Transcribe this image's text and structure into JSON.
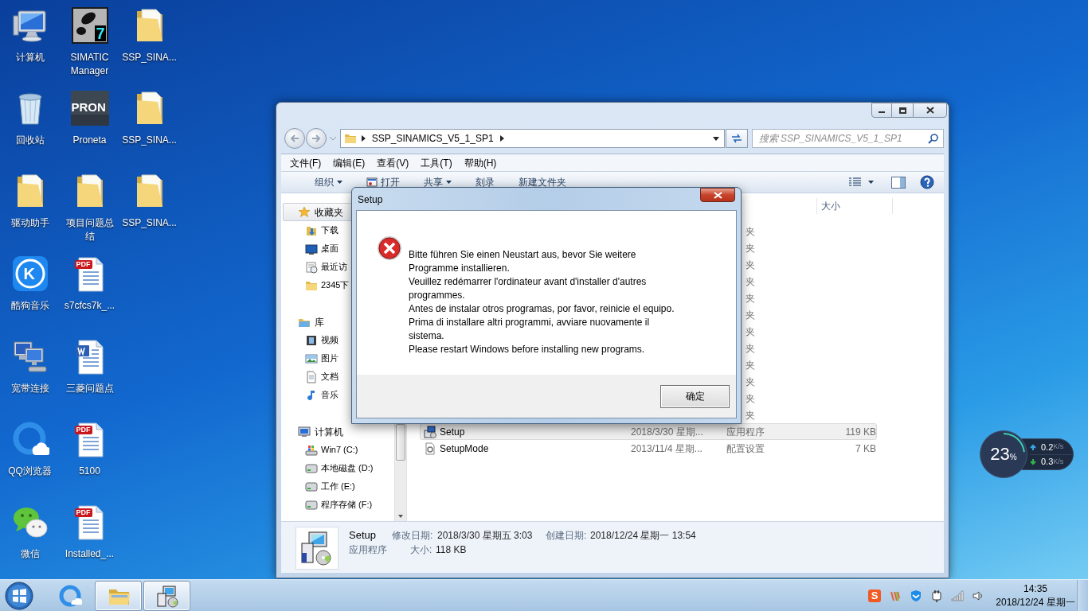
{
  "desktop": {
    "icons": [
      {
        "label": "计算机",
        "kind": "computer"
      },
      {
        "label": "回收站",
        "kind": "recycle"
      },
      {
        "label": "驱动助手",
        "kind": "folder"
      },
      {
        "label": "酷狗音乐",
        "kind": "kugou",
        "glyph": "K"
      },
      {
        "label": "宽带连接",
        "kind": "network"
      },
      {
        "label": "QQ浏览器",
        "kind": "qqbrowser"
      },
      {
        "label": "微信",
        "kind": "wechat"
      },
      {
        "label": "SIMATIC Manager",
        "kind": "simatic",
        "glyph": "7"
      },
      {
        "label": "Proneta",
        "kind": "proneta",
        "glyph": "PRON"
      },
      {
        "label": "项目问题总结",
        "kind": "folder"
      },
      {
        "label": "s7cfcs7k_...",
        "kind": "pdf",
        "glyph": "PDF"
      },
      {
        "label": "三菱问题点",
        "kind": "word"
      },
      {
        "label": "5100",
        "kind": "pdf",
        "glyph": "PDF"
      },
      {
        "label": "Installed_...",
        "kind": "pdf",
        "glyph": "PDF"
      },
      {
        "label": "SSP_SINA...",
        "kind": "folder"
      },
      {
        "label": "SSP_SINA...",
        "kind": "folder"
      },
      {
        "label": "SSP_SINA...",
        "kind": "folder"
      }
    ]
  },
  "explorer": {
    "address": {
      "crumbs": [
        "SSP_SINAMICS_V5_1_SP1"
      ]
    },
    "search": {
      "placeholder": "搜索 SSP_SINAMICS_V5_1_SP1"
    },
    "menu": [
      "文件(F)",
      "编辑(E)",
      "查看(V)",
      "工具(T)",
      "帮助(H)"
    ],
    "toolbar": [
      {
        "label": "组织",
        "kind": "dropdown"
      },
      {
        "label": "打开",
        "kind": "icon"
      },
      {
        "label": "共享",
        "kind": "dropdown"
      },
      {
        "label": "刻录",
        "kind": "plain"
      },
      {
        "label": "新建文件夹",
        "kind": "plain"
      }
    ],
    "nav": [
      {
        "label": "收藏夹",
        "kind": "star",
        "highlighted": true,
        "children": [
          {
            "label": "下载",
            "kind": "download"
          },
          {
            "label": "桌面",
            "kind": "desktop"
          },
          {
            "label": "最近访",
            "kind": "recent"
          },
          {
            "label": "2345下",
            "kind": "folder"
          }
        ]
      },
      {
        "label": "库",
        "kind": "library",
        "highlighted": false,
        "children": [
          {
            "label": "视频",
            "kind": "video"
          },
          {
            "label": "图片",
            "kind": "picture"
          },
          {
            "label": "文档",
            "kind": "document"
          },
          {
            "label": "音乐",
            "kind": "music"
          }
        ]
      },
      {
        "label": "计算机",
        "kind": "computer",
        "highlighted": false,
        "children": [
          {
            "label": "Win7 (C:)",
            "kind": "windrive"
          },
          {
            "label": "本地磁盘 (D:)",
            "kind": "drive"
          },
          {
            "label": "工作 (E:)",
            "kind": "drive"
          },
          {
            "label": "程序存储 (F:)",
            "kind": "drive"
          }
        ]
      }
    ],
    "columns": [
      {
        "label": "大小"
      }
    ],
    "rows": [
      {
        "type": "夹",
        "selected": false
      },
      {
        "type": "夹",
        "selected": false
      },
      {
        "type": "夹",
        "selected": false
      },
      {
        "type": "夹",
        "selected": false
      },
      {
        "type": "夹",
        "selected": false
      },
      {
        "type": "夹",
        "selected": false
      },
      {
        "type": "夹",
        "selected": false
      },
      {
        "type": "夹",
        "selected": false
      },
      {
        "type": "夹",
        "selected": false
      },
      {
        "type": "夹",
        "selected": false
      },
      {
        "type": "夹",
        "selected": false
      },
      {
        "type": "夹",
        "selected": false
      },
      {
        "name": "Setup",
        "kind": "setup",
        "date": "2018/3/30 星期...",
        "type": "应用程序",
        "size": "119 KB",
        "selected": true
      },
      {
        "name": "SetupMode",
        "kind": "config",
        "date": "2013/11/4 星期...",
        "type": "配置设置",
        "size": "7 KB",
        "selected": false
      }
    ],
    "details": {
      "name": "Setup",
      "type": "应用程序",
      "modified_label": "修改日期:",
      "modified": "2018/3/30 星期五 3:03",
      "created_label": "创建日期:",
      "created": "2018/12/24 星期一 13:54",
      "size_label": "大小:",
      "size": "118 KB"
    }
  },
  "dialog": {
    "title": "Setup",
    "messages": [
      "Bitte führen Sie einen Neustart aus, bevor Sie weitere Programme installieren.",
      "Veuillez redémarrer l'ordinateur avant d'installer d'autres programmes.",
      "Antes de instalar otros programas, por favor, reinicie el equipo.",
      "Prima di installare altri programmi, avviare nuovamente il sistema.",
      "Please restart Windows before installing new programs."
    ],
    "button": "确定"
  },
  "widget": {
    "percent": "23",
    "percent_unit": "%",
    "level": 0.23,
    "upload": "0.2",
    "upload_unit": "K/s",
    "download": "0.3",
    "download_unit": "K/s"
  },
  "taskbar": {
    "pinned": [
      {
        "kind": "qqbrowser",
        "active": false
      },
      {
        "kind": "explorer",
        "active": true
      },
      {
        "kind": "setup",
        "active": true
      }
    ],
    "tray": [
      {
        "kind": "sogou",
        "glyph": "S"
      },
      {
        "kind": "stripes"
      },
      {
        "kind": "shield"
      },
      {
        "kind": "plug"
      },
      {
        "kind": "signal"
      },
      {
        "kind": "volume"
      }
    ],
    "time": "14:35",
    "date": "2018/12/24 星期一"
  }
}
